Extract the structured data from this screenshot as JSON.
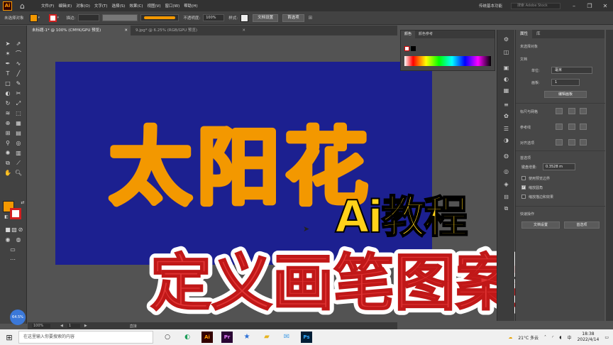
{
  "menubar": {
    "logo": "Ai",
    "items": [
      "文件(F)",
      "编辑(E)",
      "对象(O)",
      "文字(T)",
      "选择(S)",
      "效果(C)",
      "视图(V)",
      "窗口(W)",
      "帮助(H)"
    ],
    "workspace": "传统基本功能",
    "search_placeholder": "搜索 Adobe Stock"
  },
  "controlbar": {
    "selection_label": "未选择对象",
    "stroke_label": "描边:",
    "opacity_label": "不透明度:",
    "opacity_value": "100%",
    "style_label": "样式:",
    "doc_setup_btn": "文档设置",
    "prefs_btn": "首选项"
  },
  "colors": {
    "fill": "#f39800",
    "artboard": "#1c2090",
    "title_fill": "#f39800",
    "subtitle_fill": "#e03434",
    "tutorial_fill": "#ffd21a"
  },
  "doctabs": [
    {
      "label": "未标题-1* @ 100% (CMYK/GPU 预览)"
    },
    {
      "label": "9.jpg* @ 6.25% (RGB/GPU 预览)"
    }
  ],
  "artwork": {
    "title": "太阳花"
  },
  "overlay": {
    "tutorial": "Ai教程",
    "subtitle": "定义画笔图案"
  },
  "statusbar": {
    "zoom": "100%",
    "page": "1",
    "tool": "直接"
  },
  "colorpanel": {
    "tabs": [
      "颜色",
      "颜色参考"
    ]
  },
  "properties": {
    "tabs": [
      "属性",
      "库"
    ],
    "no_selection": "未选择对象",
    "document_section": "文档",
    "units_label": "单位:",
    "units_value": "毫米",
    "artboard_label": "画板:",
    "artboard_value": "1",
    "edit_artboard_btn": "编辑画板",
    "rulers_section": "标尺与网格",
    "guides_section": "参考线",
    "snap_section": "对齐选项",
    "prefs_section": "首选项",
    "keyboard_increment_label": "键盘增量:",
    "keyboard_increment_value": "0.3528 m",
    "checks": [
      {
        "label": "使用预览边界",
        "checked": false
      },
      {
        "label": "缩放圆角",
        "checked": true
      },
      {
        "label": "缩放描边和效果",
        "checked": false
      }
    ],
    "quick_actions": "快速操作",
    "doc_setup_btn": "文档设置",
    "prefs_btn": "首选项"
  },
  "taskbar": {
    "search_placeholder": "在这里输入你要搜索的内容",
    "weather": "21°C 多云",
    "time": "18:38",
    "date": "2022/4/14",
    "ime": "中",
    "apps": [
      "Ai",
      "Pr",
      "Ps"
    ]
  },
  "badge": "64.5%"
}
